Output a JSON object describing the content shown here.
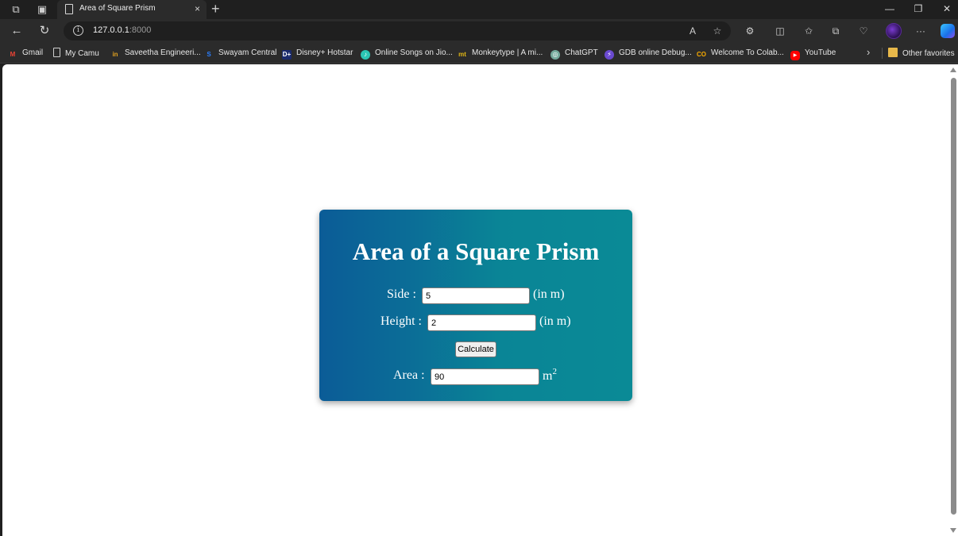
{
  "browser": {
    "tab_title": "Area of Square Prism",
    "tab_close": "×",
    "new_tab": "+",
    "url_host": "127.0.0.1",
    "url_port": ":8000",
    "window_controls": {
      "minimize": "—",
      "restore": "❐",
      "close": "✕"
    }
  },
  "bookmarks": [
    {
      "label": "Gmail",
      "icon": "gmail-icon",
      "icon_text": "M",
      "color": "#ea4335"
    },
    {
      "label": "My Camu",
      "icon": "page-icon",
      "icon_text": "",
      "color": "#cfcfcf"
    },
    {
      "label": "Saveetha Engineeri...",
      "icon": "saveetha-icon",
      "icon_text": "in",
      "color": "#e0a020"
    },
    {
      "label": "Swayam Central",
      "icon": "swayam-icon",
      "icon_text": "S",
      "color": "#2a7fff"
    },
    {
      "label": "Disney+ Hotstar",
      "icon": "hotstar-icon",
      "icon_text": "D+",
      "color": "#1a2a6c"
    },
    {
      "label": "Online Songs on Jio...",
      "icon": "jiosaavn-icon",
      "icon_text": "♪",
      "color": "#2bc5b4"
    },
    {
      "label": "Monkeytype | A mi...",
      "icon": "monkeytype-icon",
      "icon_text": "mt",
      "color": "#e2b714"
    },
    {
      "label": "ChatGPT",
      "icon": "chatgpt-icon",
      "icon_text": "◎",
      "color": "#74aa9c"
    },
    {
      "label": "GDB online Debug...",
      "icon": "gdb-icon",
      "icon_text": "⚡",
      "color": "#6a4ad0"
    },
    {
      "label": "Welcome To Colab...",
      "icon": "colab-icon",
      "icon_text": "CO",
      "color": "#f9ab00"
    },
    {
      "label": "YouTube",
      "icon": "youtube-icon",
      "icon_text": "▶",
      "color": "#ff0000"
    }
  ],
  "bookmarks_more": "›",
  "other_favorites": {
    "label": "Other favorites",
    "color": "#e8b84a"
  },
  "page": {
    "title": "Area of a Square Prism",
    "side": {
      "label": "Side :",
      "value": "5",
      "unit": "(in m)"
    },
    "height": {
      "label": "Height :",
      "value": "2",
      "unit": "(in m)"
    },
    "calculate_label": "Calculate",
    "area": {
      "label": "Area :",
      "value": "90",
      "unit": "m",
      "unit_sup": "2"
    }
  },
  "colors": {
    "card_gradient_start": "#0b5c97",
    "card_gradient_end": "#0a8a96",
    "chrome_bg": "#2b2b2b"
  }
}
